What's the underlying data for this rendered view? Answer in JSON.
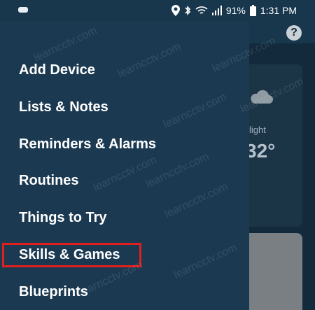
{
  "status_bar": {
    "battery": "91%",
    "time": "1:31 PM",
    "icons": [
      "notification-dots-icon",
      "location-icon",
      "bluetooth-icon",
      "wifi-icon",
      "signal-icon",
      "battery-icon"
    ]
  },
  "drawer": {
    "items": [
      {
        "label": "Add Device"
      },
      {
        "label": "Lists & Notes"
      },
      {
        "label": "Reminders & Alarms"
      },
      {
        "label": "Routines"
      },
      {
        "label": "Things to Try"
      },
      {
        "label": "Skills & Games"
      },
      {
        "label": "Blueprints"
      }
    ],
    "highlighted_item": "Skills & Games"
  },
  "background": {
    "help_symbol": "?",
    "weather_label": "light",
    "weather_temp": "32°"
  },
  "watermark": "learncctv.com",
  "colors": {
    "drawer_bg": "#1b3a52",
    "highlight_border": "#e0201e",
    "status_bar_bg": "#18374d"
  }
}
